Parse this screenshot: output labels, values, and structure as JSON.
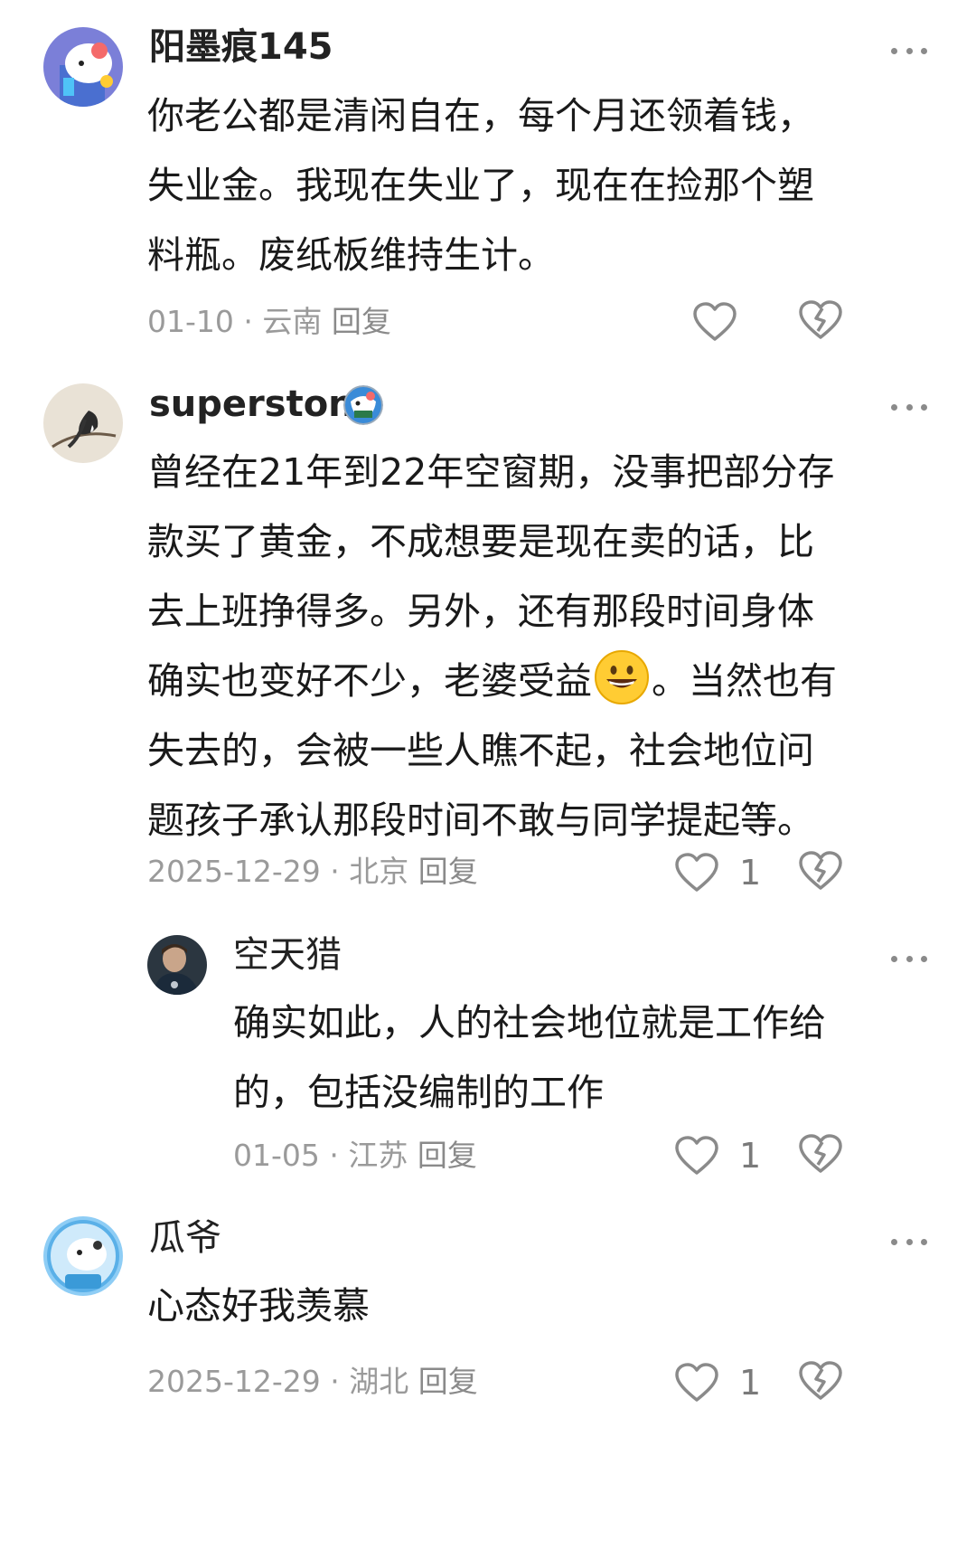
{
  "comments": [
    {
      "username": "阳墨痕145",
      "lines": [
        "你老公都是清闲自在，每个月还领着钱，",
        "失业金。我现在失业了，现在在捡那个塑",
        "料瓶。废纸板维持生计。"
      ],
      "date": "01-10",
      "location": "云南",
      "reply_label": "回复",
      "likes": "",
      "avatar_icon": "cartoon-cow-avatar-icon"
    },
    {
      "username": "superstony",
      "lines": [
        "曾经在21年到22年空窗期，没事把部分存",
        "款买了黄金，不成想要是现在卖的话，比",
        "去上班挣得多。另外，还有那段时间身体",
        "确实也变好不少，老婆受益",
        "失去的，会被一些人瞧不起，社会地位问",
        "题孩子承认那段时间不敢与同学提起等。"
      ],
      "line4_tail": "。当然也有",
      "date": "2025-12-29",
      "location": "北京",
      "reply_label": "回复",
      "likes": "1",
      "avatar_icon": "bird-painting-avatar-icon"
    },
    {
      "username": "空天猎",
      "lines": [
        "确实如此，人的社会地位就是工作给",
        "的，包括没编制的工作"
      ],
      "date": "01-05",
      "location": "江苏",
      "reply_label": "回复",
      "likes": "1",
      "avatar_icon": "person-photo-avatar-icon"
    },
    {
      "username": "瓜爷",
      "lines": [
        "心态好我羡慕"
      ],
      "date": "2025-12-29",
      "location": "湖北",
      "reply_label": "回复",
      "likes": "1",
      "avatar_icon": "cartoon-cow-astronaut-avatar-icon"
    }
  ],
  "separator": " · ",
  "colors": {
    "text": "#1a1a1a",
    "meta": "#9a9a9a",
    "icon": "#8a8a8a"
  }
}
